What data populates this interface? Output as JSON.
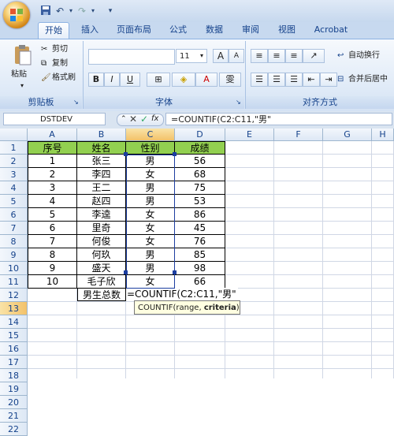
{
  "ribbon": {
    "tabs": [
      "开始",
      "插入",
      "页面布局",
      "公式",
      "数据",
      "审阅",
      "视图",
      "Acrobat"
    ],
    "clipboard": {
      "paste": "粘贴",
      "cut": "剪切",
      "copy": "复制",
      "format_painter": "格式刷",
      "label": "剪贴板"
    },
    "font": {
      "size": "11",
      "grow": "A",
      "shrink": "A",
      "bold": "B",
      "italic": "I",
      "underline": "U",
      "font_color": "A",
      "phonetic": "雯",
      "label": "字体"
    },
    "alignment": {
      "wrap_text": "自动换行",
      "merge_center": "合并后居中",
      "label": "对齐方式"
    }
  },
  "formula_bar": {
    "name_box": "DSTDEV",
    "fx": "fx",
    "formula": "=COUNTIF(C2:C11,\"男\""
  },
  "columns": [
    "A",
    "B",
    "C",
    "D",
    "E",
    "F",
    "G",
    "H"
  ],
  "rows": [
    "1",
    "2",
    "3",
    "4",
    "5",
    "6",
    "7",
    "8",
    "9",
    "10",
    "11",
    "12",
    "13",
    "14",
    "15",
    "16",
    "17",
    "18",
    "19",
    "20",
    "21",
    "22"
  ],
  "table": {
    "header": [
      "序号",
      "姓名",
      "性别",
      "成绩"
    ],
    "data": [
      [
        "1",
        "张三",
        "男",
        "56"
      ],
      [
        "2",
        "李四",
        "女",
        "68"
      ],
      [
        "3",
        "王二",
        "男",
        "75"
      ],
      [
        "4",
        "赵四",
        "男",
        "53"
      ],
      [
        "5",
        "李逵",
        "女",
        "86"
      ],
      [
        "6",
        "里奇",
        "女",
        "45"
      ],
      [
        "7",
        "何俊",
        "女",
        "76"
      ],
      [
        "8",
        "何玖",
        "男",
        "85"
      ],
      [
        "9",
        "盛天",
        "男",
        "98"
      ],
      [
        "10",
        "毛子欣",
        "女",
        "66"
      ]
    ]
  },
  "row13": {
    "label": "男生总数",
    "formula": "=COUNTIF(C2:C11,\"男\""
  },
  "tooltip": {
    "func": "COUNTIF(range, ",
    "bold_arg": "criteria",
    "close": ")"
  }
}
